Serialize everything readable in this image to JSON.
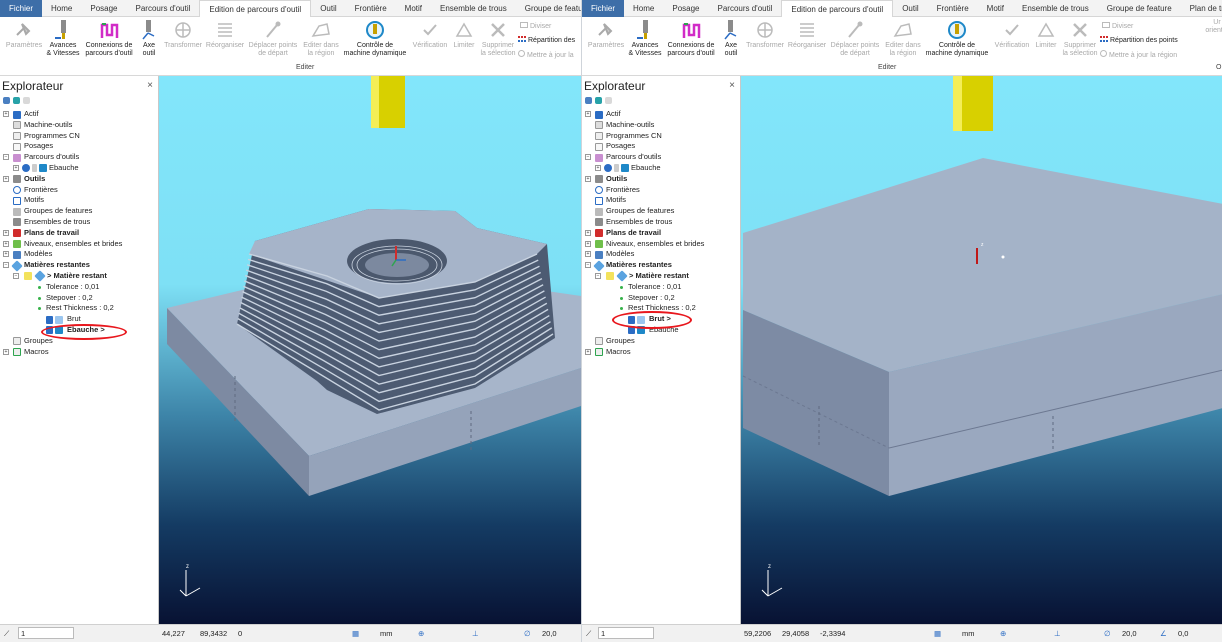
{
  "tabs": [
    "Fichier",
    "Home",
    "Posage",
    "Parcours d'outil",
    "Edition de parcours d'outil",
    "Outil",
    "Frontière",
    "Motif",
    "Ensemble de trous",
    "Groupe de feature",
    "Plan de travail"
  ],
  "ribbon": {
    "params": "Paramètres",
    "feeds": "Avances\n& Vitesses",
    "links": "Connexions de\nparcours d'outil",
    "axis": "Axe\noutil",
    "transform": "Transformer",
    "reorder": "Réorganiser",
    "move_start": "Déplacer points\nde départ",
    "edit_region": "Editer dans\nla région",
    "dynamic": "Contrôle de\nmachine dynamique",
    "verify": "Vérification",
    "limit": "Limiter",
    "delete_sel": "Supprimer\nla sélection",
    "divide": "Diviser",
    "repartition_left": "Répartition des",
    "repartition_right": "Répartition des points",
    "update": "Mettre à jour la",
    "update_right": "Mettre à jour la région",
    "group_label": "Editer",
    "orient_partial": "Ur\norientat",
    "o_partial": "O"
  },
  "explorer": {
    "title": "Explorateur",
    "close": "×",
    "nodes": {
      "actif": "Actif",
      "machines": "Machine-outils",
      "programs": "Programmes CN",
      "posages": "Posages",
      "toolpaths": "Parcours d'outils",
      "ebauche": "Ebauche",
      "tools": "Outils",
      "boundaries": "Frontières",
      "patterns": "Motifs",
      "feature_groups": "Groupes de features",
      "hole_sets": "Ensembles de trous",
      "workplanes": "Plans de travail",
      "levels": "Niveaux, ensembles et brides",
      "models": "Modèles",
      "stock_models": "Matières restantes",
      "stock_model": "> Matière restant",
      "tolerance": "Tolerance  :  0,01",
      "stepover": "Stepover  :  0,2",
      "rest_thickness": "Rest Thickness  :  0,2",
      "brut": "Brut",
      "brut_active": "Brut >",
      "ebauche_child": "Ebauche >",
      "ebauche_plain": "Ebauche",
      "groups": "Groupes",
      "macros": "Macros"
    }
  },
  "status_left": {
    "layer": "1",
    "x": "44,227",
    "y": "89,3432",
    "z": "0",
    "units": "mm",
    "tol": "20,0"
  },
  "status_right": {
    "layer": "1",
    "x": "59,2206",
    "y": "29,4058",
    "z": "-2,3394",
    "units": "mm",
    "tol": "20,0",
    "angle": "0,0"
  },
  "colors": {
    "file_tab": "#3d6ea8",
    "highlight": "#e8171d",
    "tool_yellow": "#d8d000",
    "block": "#a3b1c7"
  }
}
